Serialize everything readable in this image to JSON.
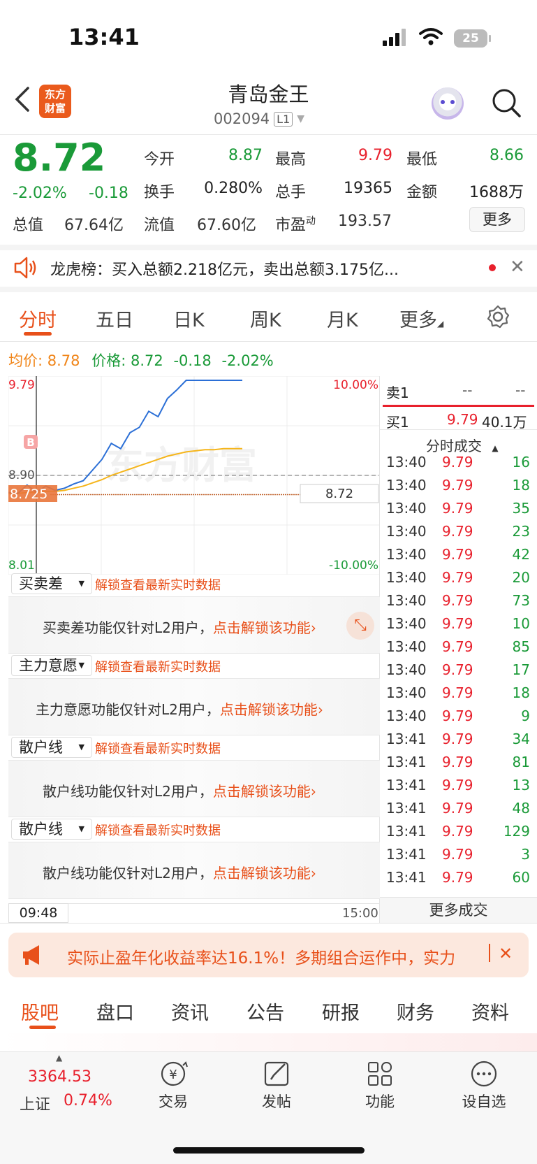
{
  "status_bar": {
    "time": "13:41",
    "battery": "25"
  },
  "header": {
    "logo_text_1": "东方",
    "logo_text_2": "财富",
    "stock_name": "青岛金王",
    "stock_code": "002094",
    "level": "L1"
  },
  "quote": {
    "price": "8.72",
    "change_pct": "-2.02%",
    "change": "-0.18",
    "rows": [
      [
        {
          "label": "今开",
          "value": "8.87",
          "color": "green"
        },
        {
          "label": "最高",
          "value": "9.79",
          "color": "red"
        },
        {
          "label": "最低",
          "value": "8.66",
          "color": "green"
        }
      ],
      [
        {
          "label": "换手",
          "value": "0.280%",
          "color": "plain"
        },
        {
          "label": "总手",
          "value": "19365",
          "color": "plain"
        },
        {
          "label": "金额",
          "value": "1688万",
          "color": "plain"
        }
      ]
    ],
    "total_value_label": "总值",
    "total_value": "67.64亿",
    "float_value_label": "流值",
    "float_value": "67.60亿",
    "pe_label": "市盈",
    "pe_sup": "动",
    "pe_value": "193.57",
    "more_button": "更多"
  },
  "notice": {
    "text": "龙虎榜：买入总额2.218亿元，卖出总额3.175亿..."
  },
  "chart_tabs": [
    "分时",
    "五日",
    "日K",
    "周K",
    "月K",
    "更多"
  ],
  "info_line": {
    "avg_label": "均价:",
    "avg_value": "8.78",
    "price_label": "价格:",
    "price_value": "8.72",
    "change": "-0.18",
    "change_pct": "-2.02%"
  },
  "chart_data": {
    "type": "line",
    "series": [
      {
        "color": "#2b6fd6",
        "values": [
          8.74,
          8.73,
          8.81,
          8.74,
          8.8,
          8.76,
          8.78,
          8.82,
          8.85,
          8.95,
          9.05,
          9.2,
          9.15,
          9.3,
          9.35,
          9.5,
          9.45,
          9.62,
          9.7,
          9.79,
          9.79,
          9.79,
          9.79,
          9.79,
          9.79,
          9.79
        ]
      },
      {
        "color": "#f5b51b",
        "values": [
          8.73,
          8.73,
          8.74,
          8.74,
          8.75,
          8.75,
          8.76,
          8.78,
          8.8,
          8.83,
          8.86,
          8.9,
          8.93,
          8.96,
          8.99,
          9.02,
          9.05,
          9.08,
          9.1,
          9.12,
          9.13,
          9.14,
          9.14,
          9.15,
          9.15,
          9.15
        ]
      }
    ],
    "y_labels": {
      "top": "9.79",
      "bottom": "8.01",
      "top_pct": "10.00%",
      "bottom_pct": "-10.00%"
    },
    "ylim": [
      8.01,
      9.79
    ],
    "ref_line": {
      "label": "8.90",
      "value": 8.9
    },
    "cursor_label": "8.725",
    "current_label": "8.72",
    "current_value": 8.72,
    "buy_marker": "B",
    "x_labels": {
      "start": "09:48",
      "end": "15:00"
    },
    "watermark": "东方财富"
  },
  "order_book": {
    "sell1_label": "卖1",
    "sell1_price": "--",
    "sell1_vol": "--",
    "buy1_label": "买1",
    "buy1_price": "9.79",
    "buy1_vol": "40.1万",
    "trades_header": "分时成交",
    "trades": [
      {
        "time": "13:40",
        "price": "9.79",
        "vol": "16"
      },
      {
        "time": "13:40",
        "price": "9.79",
        "vol": "18"
      },
      {
        "time": "13:40",
        "price": "9.79",
        "vol": "35"
      },
      {
        "time": "13:40",
        "price": "9.79",
        "vol": "23"
      },
      {
        "time": "13:40",
        "price": "9.79",
        "vol": "42"
      },
      {
        "time": "13:40",
        "price": "9.79",
        "vol": "20"
      },
      {
        "time": "13:40",
        "price": "9.79",
        "vol": "73"
      },
      {
        "time": "13:40",
        "price": "9.79",
        "vol": "10"
      },
      {
        "time": "13:40",
        "price": "9.79",
        "vol": "85"
      },
      {
        "time": "13:40",
        "price": "9.79",
        "vol": "17"
      },
      {
        "time": "13:40",
        "price": "9.79",
        "vol": "18"
      },
      {
        "time": "13:40",
        "price": "9.79",
        "vol": "9"
      },
      {
        "time": "13:41",
        "price": "9.79",
        "vol": "34"
      },
      {
        "time": "13:41",
        "price": "9.79",
        "vol": "81"
      },
      {
        "time": "13:41",
        "price": "9.79",
        "vol": "13"
      },
      {
        "time": "13:41",
        "price": "9.79",
        "vol": "48"
      },
      {
        "time": "13:41",
        "price": "9.79",
        "vol": "129"
      },
      {
        "time": "13:41",
        "price": "9.79",
        "vol": "3"
      },
      {
        "time": "13:41",
        "price": "9.79",
        "vol": "60"
      }
    ],
    "more_trades": "更多成交"
  },
  "l2_panels": [
    {
      "select": "买卖差",
      "unlock": "解锁查看最新实时数据",
      "msg": "买卖差功能仅针对L2用户，",
      "link": "点击解锁该功能"
    },
    {
      "select": "主力意愿",
      "unlock": "解锁查看最新实时数据",
      "msg": "主力意愿功能仅针对L2用户，",
      "link": "点击解锁该功能"
    },
    {
      "select": "散户线",
      "unlock": "解锁查看最新实时数据",
      "msg": "散户线功能仅针对L2用户，",
      "link": "点击解锁该功能"
    },
    {
      "select": "散户线",
      "unlock": "解锁查看最新实时数据",
      "msg": "散户线功能仅针对L2用户，",
      "link": "点击解锁该功能"
    }
  ],
  "ad": {
    "text": "实际止盈年化收益率达16.1%！多期组合运作中，实力"
  },
  "bottom_tabs": [
    "股吧",
    "盘口",
    "资讯",
    "公告",
    "研报",
    "财务",
    "资料"
  ],
  "bottom_nav": {
    "index_value": "3364.53",
    "index_name": "上证",
    "index_pct": "0.74%",
    "items": [
      {
        "label": "交易",
        "icon": "trade-icon"
      },
      {
        "label": "发帖",
        "icon": "post-icon"
      },
      {
        "label": "功能",
        "icon": "function-icon"
      },
      {
        "label": "设自选",
        "icon": "add-favorite-icon"
      }
    ]
  },
  "colors": {
    "accent": "#e8501a",
    "up": "#e8202c",
    "down": "#1a9a38",
    "price_line": "#2b6fd6",
    "avg_line": "#f5b51b"
  }
}
